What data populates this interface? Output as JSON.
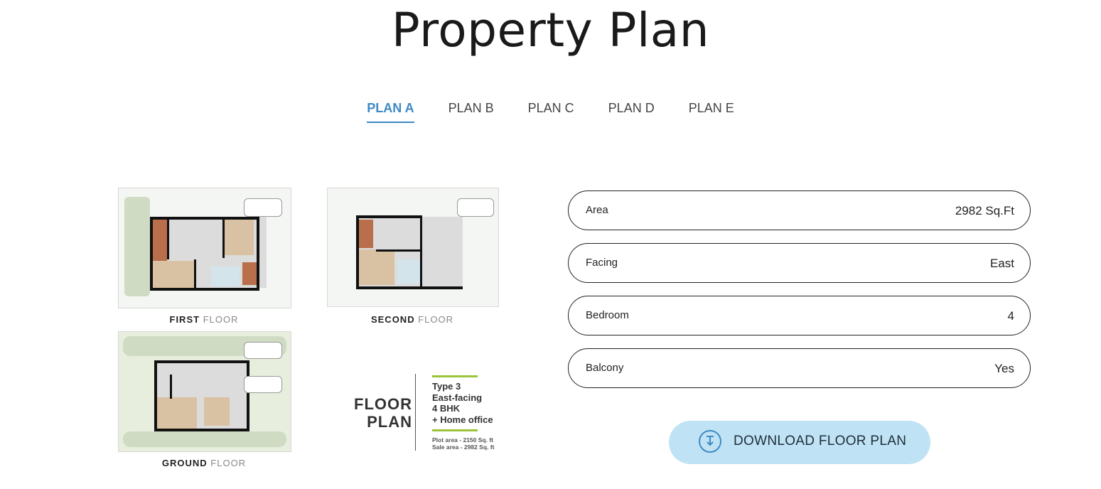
{
  "page": {
    "title": "Property Plan"
  },
  "tabs": [
    {
      "label": "PLAN A",
      "active": true
    },
    {
      "label": "PLAN B",
      "active": false
    },
    {
      "label": "PLAN C",
      "active": false
    },
    {
      "label": "PLAN D",
      "active": false
    },
    {
      "label": "PLAN E",
      "active": false
    }
  ],
  "floor_plan": {
    "captions": {
      "first_bold": "FIRST",
      "first_light": "FLOOR",
      "second_bold": "SECOND",
      "second_light": "FLOOR",
      "ground_bold": "GROUND",
      "ground_light": "FLOOR"
    },
    "title_line1": "FLOOR",
    "title_line2": "PLAN",
    "type_lines": [
      "Type 3",
      "East-facing",
      "4 BHK",
      "+ Home office"
    ],
    "plot_area": "Plot area - 2150 Sq. ft",
    "sale_area": "Sale area - 2982 Sq. ft",
    "accent_color": "#9bc43a"
  },
  "details": [
    {
      "label": "Area",
      "value": "2982 Sq.Ft"
    },
    {
      "label": "Facing",
      "value": "East"
    },
    {
      "label": "Bedroom",
      "value": "4"
    },
    {
      "label": "Balcony",
      "value": "Yes"
    }
  ],
  "download": {
    "label": "DOWNLOAD FLOOR PLAN",
    "icon": "download-icon"
  },
  "colors": {
    "accent": "#3e8ac4",
    "button_bg": "#bfe3f4"
  }
}
